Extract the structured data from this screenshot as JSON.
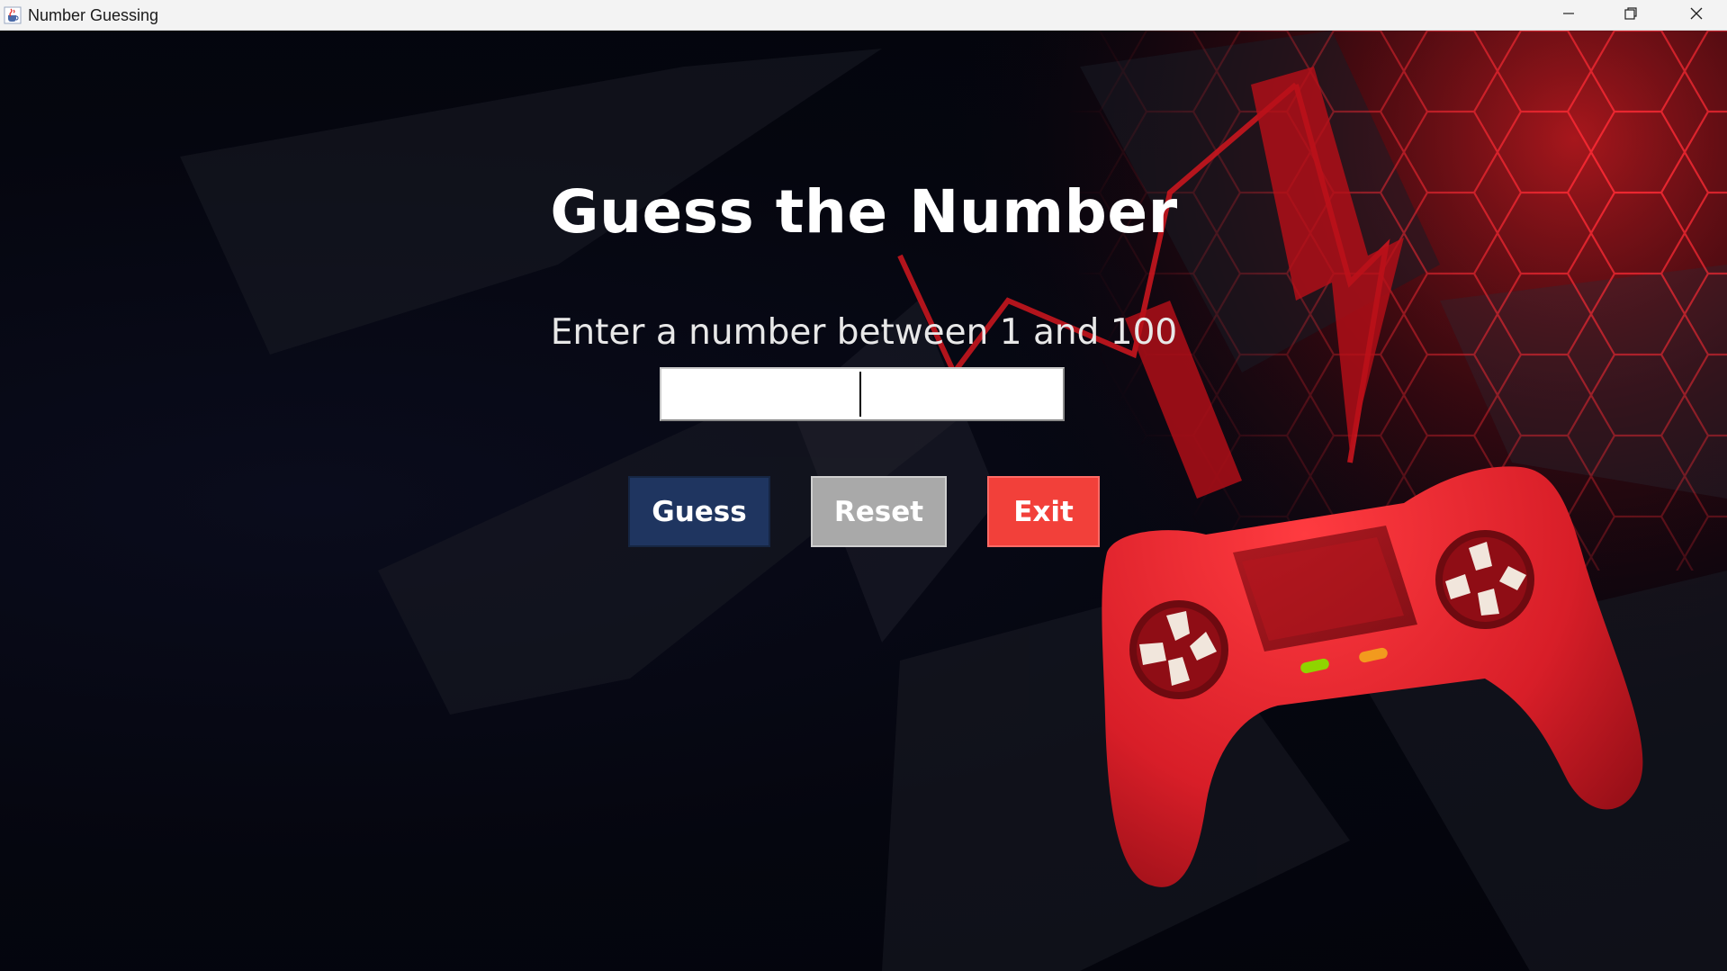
{
  "window": {
    "title": "Number Guessing",
    "app_icon": "java-cup-icon",
    "controls": {
      "minimize_icon": "minimize-icon",
      "maximize_icon": "restore-icon",
      "close_icon": "close-icon"
    }
  },
  "main": {
    "heading": "Guess the Number",
    "prompt": "Enter a number between 1 and 100",
    "guess_input": {
      "value": "",
      "placeholder": ""
    },
    "buttons": {
      "guess_label": "Guess",
      "reset_label": "Reset",
      "exit_label": "Exit"
    }
  },
  "colors": {
    "background": "#05060f",
    "guess_button": "#1f3560",
    "reset_button": "#a9a9a9",
    "exit_button": "#f2403a",
    "accent_red": "#e0202a"
  }
}
